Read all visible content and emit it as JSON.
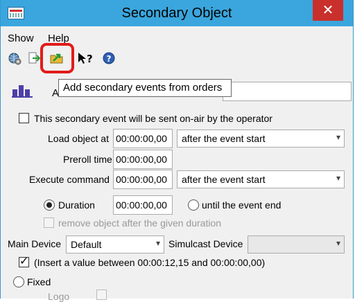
{
  "window": {
    "title": "Secondary Object",
    "close_glyph": "✕"
  },
  "menu": {
    "items": [
      "Show",
      "Help"
    ]
  },
  "toolbar": {
    "icons": [
      "globe-settings-icon",
      "import-icon",
      "add-from-orders-folder-icon",
      "context-help-pointer-icon",
      "help-icon"
    ],
    "highlight_color": "#e21b1b",
    "tooltip": "Add secondary events from orders"
  },
  "form": {
    "label_a": "A",
    "onair_checkbox": {
      "label": "This secondary event will be sent on-air by the operator",
      "checked": false
    },
    "load_object": {
      "label": "Load object at",
      "time": "00:00:00,00",
      "relation": "after the event start"
    },
    "preroll": {
      "label": "Preroll time",
      "time": "00:00:00,00"
    },
    "execute": {
      "label": "Execute command",
      "time": "00:00:00,00",
      "relation": "after the event start"
    },
    "duration": {
      "label": "Duration",
      "selected": true,
      "time": "00:00:00,00"
    },
    "until_end": {
      "label": "until the event end",
      "selected": false
    },
    "remove_after": {
      "label": "remove object after the given duration",
      "checked": false,
      "disabled": true
    },
    "main_device": {
      "label": "Main Device",
      "value": "Default"
    },
    "simulcast_device": {
      "label": "Simulcast Device",
      "value": ""
    },
    "insert_value": {
      "label": "(Insert a value between 00:00:12,15 and 00:00:00,00)",
      "checked": true
    },
    "fixed": {
      "label": "Fixed",
      "selected": false
    },
    "logo": {
      "label": "Logo"
    }
  },
  "colors": {
    "titlebar": "#3aa6dd",
    "close": "#c9302c"
  }
}
